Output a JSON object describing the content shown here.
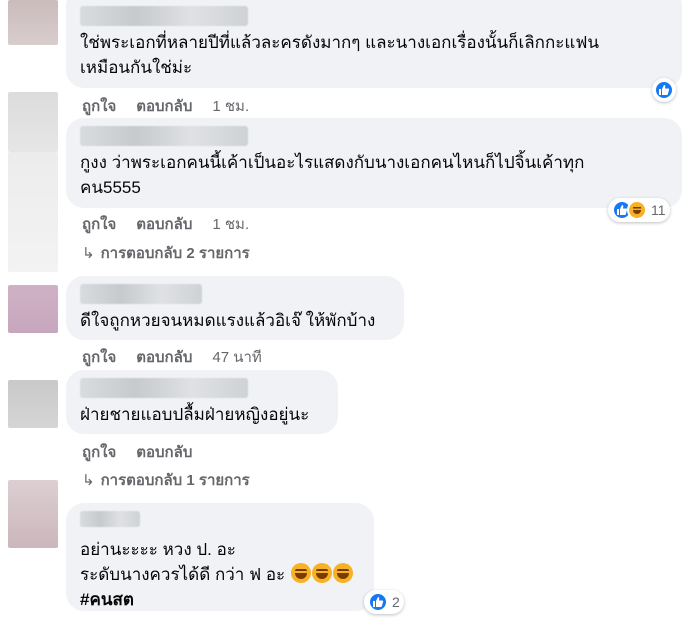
{
  "comments": [
    {
      "text": "ใช่พระเอกที่หลายปีที่แล้วละครดังมากๆ และนางเอกเรื่องนั้นก็เลิกกะแฟน\nเหมือนกันใช่ม่ะ",
      "like_label": "ถูกใจ",
      "reply_label": "ตอบกลับ",
      "time": "1 ชม.",
      "reactions": {
        "icons": [
          "like-icon"
        ],
        "count": ""
      }
    },
    {
      "text": "กูงง ว่าพระเอกคนนี้เค้าเป็นอะไรแสดงกับนางเอกคนไหนก็ไปจิ้นเค้าทุก\nคน5555",
      "like_label": "ถูกใจ",
      "reply_label": "ตอบกลับ",
      "time": "1 ชม.",
      "reactions": {
        "icons": [
          "like-icon",
          "haha-icon"
        ],
        "count": "11"
      },
      "replies": "การตอบกลับ 2 รายการ"
    },
    {
      "text": "ดีใจถูกหวยจนหมดแรงแล้วอิเจ๊ ให้พักบ้าง",
      "like_label": "ถูกใจ",
      "reply_label": "ตอบกลับ",
      "time": "47 นาที"
    },
    {
      "text": "ฝ่ายชายแอบปลื้มฝ่ายหญิงอยู่นะ",
      "like_label": "ถูกใจ",
      "reply_label": "ตอบกลับ",
      "replies": "การตอบกลับ 1 รายการ"
    },
    {
      "text_line1": "อย่านะะะะ หวง ป. อะ",
      "text_line2": "ระดับนางควรได้ดี กว่า ฟ อะ",
      "hashtag": "#คนสต",
      "reactions": {
        "icons": [
          "like-icon"
        ],
        "count": "2"
      }
    }
  ],
  "colors": {
    "bubble": "#f0f2f5",
    "meta": "#65676b",
    "like": "#1877f2",
    "haha": "#f7b125"
  }
}
